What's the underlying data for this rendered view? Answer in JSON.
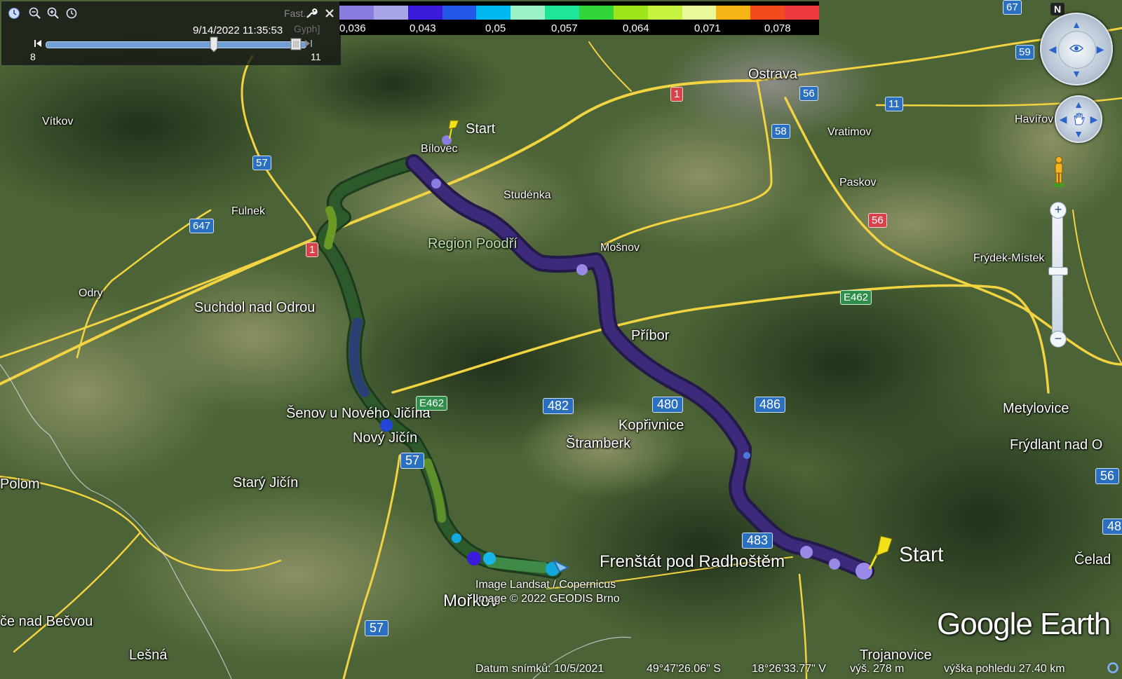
{
  "app": {
    "brand": "Google Earth"
  },
  "time_slider": {
    "date_label": "9/14/2022  11:35:53",
    "min_label": "8",
    "max_label": "11",
    "ghost_title": "Fast...",
    "ghost_sub": "Gyph]",
    "position_fraction": 0.66,
    "icons": [
      "clock-icon",
      "zoom-out-icon",
      "zoom-in-icon",
      "history-icon",
      "wrench-icon",
      "close-icon",
      "skip-back-icon",
      "skip-forward-icon"
    ]
  },
  "legend": {
    "colors": [
      "#8a7de0",
      "#a9a6e8",
      "#3a1bdc",
      "#2257e8",
      "#00b8f0",
      "#9cf3c8",
      "#1fe59a",
      "#32d63a",
      "#9ce619",
      "#c5f23f",
      "#e9f89a",
      "#f6b514",
      "#f34b1e",
      "#ef3b3f"
    ],
    "labels": [
      "0,036",
      "0,043",
      "0,05",
      "0,057",
      "0,064",
      "0,071",
      "0,078"
    ]
  },
  "places": [
    {
      "name": "Ostrava",
      "size": "med"
    },
    {
      "name": "Vítkov",
      "size": "sm"
    },
    {
      "name": "Bílovec",
      "size": "sm"
    },
    {
      "name": "Studénka",
      "size": "sm"
    },
    {
      "name": "Fulnek",
      "size": "sm"
    },
    {
      "name": "Vratimov",
      "size": "sm"
    },
    {
      "name": "Havířov",
      "size": "sm"
    },
    {
      "name": "Paskov",
      "size": "sm"
    },
    {
      "name": "Region Poodří",
      "size": "region"
    },
    {
      "name": "Mošnov",
      "size": "sm"
    },
    {
      "name": "Frýdek-Místek",
      "size": "sm"
    },
    {
      "name": "Odry",
      "size": "sm"
    },
    {
      "name": "Suchdol nad Odrou",
      "size": "med"
    },
    {
      "name": "Příbor",
      "size": "med"
    },
    {
      "name": "Šenov u Nového Jičína",
      "size": "med"
    },
    {
      "name": "Nový Jičín",
      "size": "med"
    },
    {
      "name": "Kopřivnice",
      "size": "med"
    },
    {
      "name": "Štramberk",
      "size": "med"
    },
    {
      "name": "Metylovice",
      "size": "med"
    },
    {
      "name": "Frýdlant nad O",
      "size": "med"
    },
    {
      "name": "Polom",
      "size": "med"
    },
    {
      "name": "Starý Jičín",
      "size": "med"
    },
    {
      "name": "Frenštát pod Radhoštěm",
      "size": "big"
    },
    {
      "name": "Čelad",
      "size": "med"
    },
    {
      "name": "Mořkov",
      "size": "med"
    },
    {
      "name": "če nad Bečvou",
      "size": "med"
    },
    {
      "name": "Lešná",
      "size": "med"
    },
    {
      "name": "Trojanovice",
      "size": "med"
    }
  ],
  "shields": [
    {
      "label": "57",
      "kind": "blue"
    },
    {
      "label": "647",
      "kind": "blue"
    },
    {
      "label": "1",
      "kind": "red"
    },
    {
      "label": "1",
      "kind": "red"
    },
    {
      "label": "56",
      "kind": "blue"
    },
    {
      "label": "58",
      "kind": "blue"
    },
    {
      "label": "11",
      "kind": "blue"
    },
    {
      "label": "56",
      "kind": "red"
    },
    {
      "label": "59",
      "kind": "blue"
    },
    {
      "label": "E462",
      "kind": "green"
    },
    {
      "label": "E462",
      "kind": "green"
    },
    {
      "label": "482",
      "kind": "blue"
    },
    {
      "label": "480",
      "kind": "blue"
    },
    {
      "label": "486",
      "kind": "blue"
    },
    {
      "label": "57",
      "kind": "blue"
    },
    {
      "label": "483",
      "kind": "blue"
    },
    {
      "label": "57",
      "kind": "blue"
    },
    {
      "label": "56",
      "kind": "blue"
    },
    {
      "label": "48",
      "kind": "blue"
    },
    {
      "label": "67",
      "kind": "blue"
    }
  ],
  "markers": [
    {
      "label": "Start"
    },
    {
      "label": "Start"
    }
  ],
  "attribution": {
    "line1": "Image Landsat / Copernicus",
    "line2": "Image © 2022 GEODIS Brno"
  },
  "status": {
    "date": "Datum snímků: 10/5/2021",
    "lat": "49°47'26.06\" S",
    "lon": "18°26'33.77\" V",
    "elev": "výš.   278 m",
    "eye": "výška pohledu  27.40 km"
  },
  "navigation": {
    "north_label": "N"
  }
}
